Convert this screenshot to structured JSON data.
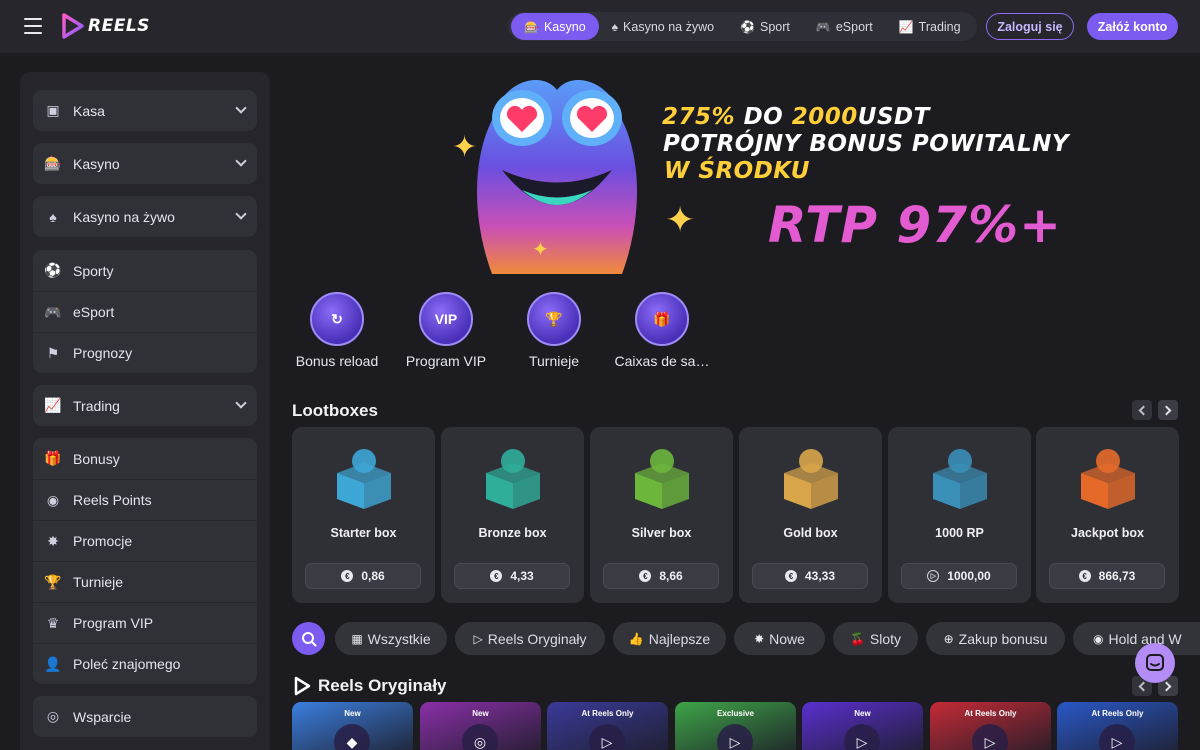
{
  "brand": {
    "name": "REELS"
  },
  "topnav": [
    {
      "label": "Kasyno",
      "icon": "slot-icon",
      "active": true
    },
    {
      "label": "Kasyno na żywo",
      "icon": "dealer-icon",
      "active": false
    },
    {
      "label": "Sport",
      "icon": "ball-icon",
      "active": false
    },
    {
      "label": "eSport",
      "icon": "gamepad-icon",
      "active": false
    },
    {
      "label": "Trading",
      "icon": "chart-icon",
      "active": false
    }
  ],
  "auth": {
    "login_label": "Zaloguj się",
    "register_label": "Załóż konto"
  },
  "sidebar": {
    "group1": [
      {
        "label": "Kasa",
        "icon": "wallet-icon"
      }
    ],
    "group2": [
      {
        "label": "Kasyno",
        "icon": "slot-icon"
      }
    ],
    "group3": [
      {
        "label": "Kasyno na żywo",
        "icon": "dealer-icon"
      }
    ],
    "group4": [
      {
        "label": "Sporty",
        "icon": "ball-icon"
      },
      {
        "label": "eSport",
        "icon": "gamepad-icon"
      },
      {
        "label": "Prognozy",
        "icon": "prediction-icon"
      }
    ],
    "group5": [
      {
        "label": "Trading",
        "icon": "chart-icon"
      }
    ],
    "group6": [
      {
        "label": "Bonusy",
        "icon": "gift-icon"
      },
      {
        "label": "Reels Points",
        "icon": "points-icon"
      },
      {
        "label": "Promocje",
        "icon": "star-icon"
      },
      {
        "label": "Turnieje",
        "icon": "trophy-icon"
      },
      {
        "label": "Program VIP",
        "icon": "crown-icon"
      },
      {
        "label": "Poleć znajomego",
        "icon": "person-icon"
      }
    ],
    "group7": [
      {
        "label": "Wsparcie",
        "icon": "support-icon"
      }
    ]
  },
  "banner": {
    "line1_pct": "275%",
    "line1_mid": "DO",
    "line1_amount": "2000",
    "line1_currency": "USDT",
    "line2": "POTRÓJNY BONUS POWITALNY",
    "line3": "W ŚRODKU",
    "rtp": "RTP 97%+"
  },
  "quick_links": [
    {
      "label": "Bonus reload",
      "icon": "reload-icon",
      "glyph": "↻"
    },
    {
      "label": "Program VIP",
      "icon": "vip-icon",
      "glyph": "VIP"
    },
    {
      "label": "Turnieje",
      "icon": "trophy-icon",
      "glyph": "🏆"
    },
    {
      "label": "Caixas de sa…",
      "icon": "box-icon",
      "glyph": "🎁"
    }
  ],
  "lootboxes": {
    "title": "Lootboxes",
    "items": [
      {
        "name": "Starter box",
        "price": "0,86",
        "currency": "€",
        "color": "#3ea7d6"
      },
      {
        "name": "Bronze box",
        "price": "4,33",
        "currency": "€",
        "color": "#2fae9a"
      },
      {
        "name": "Silver box",
        "price": "8,66",
        "currency": "€",
        "color": "#6cb63c"
      },
      {
        "name": "Gold box",
        "price": "43,33",
        "currency": "€",
        "color": "#d9a54a"
      },
      {
        "name": "1000 RP",
        "price": "1000,00",
        "currency": "RP",
        "color": "#3a8fb8"
      },
      {
        "name": "Jackpot box",
        "price": "866,73",
        "currency": "€",
        "color": "#e56a2a"
      }
    ]
  },
  "filters": [
    {
      "label": "Wszystkie",
      "icon": "grid-icon",
      "glyph": "▦"
    },
    {
      "label": "Reels Oryginały",
      "icon": "reels-icon",
      "glyph": "▷"
    },
    {
      "label": "Najlepsze",
      "icon": "thumbs-up-icon",
      "glyph": "👍"
    },
    {
      "label": "Nowe",
      "icon": "new-icon",
      "glyph": "✸"
    },
    {
      "label": "Sloty",
      "icon": "cherry-icon",
      "glyph": "🍒"
    },
    {
      "label": "Zakup bonusu",
      "icon": "bonus-buy-icon",
      "glyph": "⊕"
    },
    {
      "label": "Hold and W",
      "icon": "coins-icon",
      "glyph": "◉"
    }
  ],
  "originals": {
    "title": "Reels Oryginały",
    "cards": [
      {
        "tag": "New",
        "color": "#3b7fe0"
      },
      {
        "tag": "New",
        "color": "#8a2fa8"
      },
      {
        "tag": "At Reels Only",
        "color": "#3a3a9a"
      },
      {
        "tag": "Exclusive",
        "color": "#3ea548"
      },
      {
        "tag": "New",
        "color": "#5a2fd0"
      },
      {
        "tag": "At Reels Only",
        "color": "#c42a36"
      },
      {
        "tag": "At Reels Only",
        "color": "#2a58c8"
      }
    ]
  }
}
